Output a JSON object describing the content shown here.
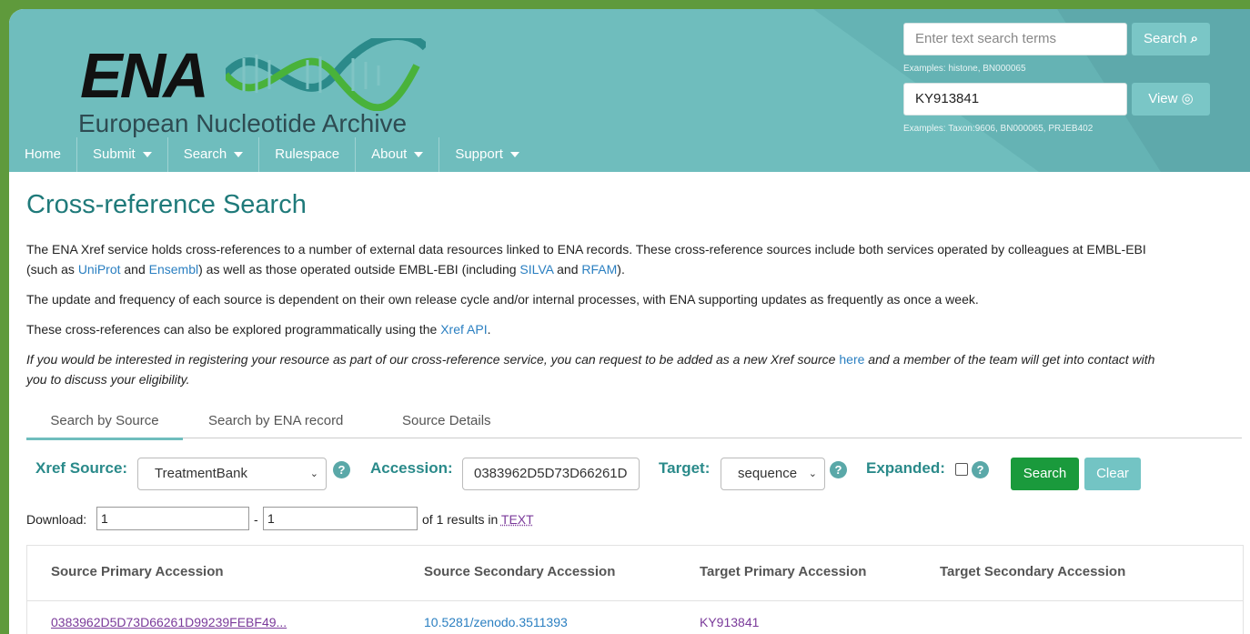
{
  "header": {
    "logo_text": "ENA",
    "logo_subtitle": "European Nucleotide Archive",
    "search_placeholder": "Enter text search terms",
    "search_button": "Search",
    "search_examples": "Examples: histone, BN000065",
    "view_value": "KY913841",
    "view_button": "View",
    "view_examples": "Examples: Taxon:9606, BN000065, PRJEB402"
  },
  "nav": {
    "items": [
      {
        "label": "Home",
        "dropdown": false
      },
      {
        "label": "Submit",
        "dropdown": true
      },
      {
        "label": "Search",
        "dropdown": true
      },
      {
        "label": "Rulespace",
        "dropdown": false
      },
      {
        "label": "About",
        "dropdown": true
      },
      {
        "label": "Support",
        "dropdown": true
      }
    ]
  },
  "page": {
    "title": "Cross-reference Search",
    "p1_a": "The ENA Xref service holds cross-references to a number of external data resources linked to ENA records. These cross-reference sources include both services operated by colleagues at EMBL-EBI",
    "p1_b": "(such as ",
    "p1_link_uniprot": "UniProt",
    "p1_and1": " and ",
    "p1_link_ensembl": "Ensembl",
    "p1_c": ") as well as those operated outside EMBL-EBI (including ",
    "p1_link_silva": "SILVA",
    "p1_and2": " and ",
    "p1_link_rfam": "RFAM",
    "p1_end": ").",
    "p2": "The update and frequency of each source is dependent on their own release cycle and/or internal processes, with ENA supporting updates as frequently as once a week.",
    "p3_a": "These cross-references can also be explored programmatically using the ",
    "p3_link": "Xref API",
    "p3_end": ".",
    "p4_a": "If you would be interested in registering your resource as part of our cross-reference service, you can request to be added as a new Xref source ",
    "p4_link": "here",
    "p4_b": " and a member of the team will get into contact with",
    "p4_c": "you to discuss your eligibility."
  },
  "tabs": [
    "Search by Source",
    "Search by ENA record",
    "Source Details"
  ],
  "form": {
    "xref_label": "Xref Source:",
    "xref_value": "TreatmentBank",
    "accession_label": "Accession:",
    "accession_value": "0383962D5D73D66261D",
    "target_label": "Target:",
    "target_value": "sequence",
    "expanded_label": "Expanded:",
    "help_glyph": "?",
    "search_button": "Search",
    "clear_button": "Clear"
  },
  "download": {
    "label": "Download:",
    "from": "1",
    "dash": "-",
    "to": "1",
    "results_text": "of 1 results in",
    "format_link": "TEXT"
  },
  "table": {
    "headers": [
      "Source Primary Accession",
      "Source Secondary Accession",
      "Target Primary Accession",
      "Target Secondary Accession"
    ],
    "rows": [
      [
        "0383962D5D73D66261D99239FEBF49...",
        "10.5281/zenodo.3511393",
        "KY913841",
        ""
      ]
    ]
  },
  "colors": {
    "header_bg": "#6fbdbd",
    "title": "#1f7a7a",
    "search_green": "#1a9a3c",
    "clear_teal": "#73c4c4",
    "link_blue": "#2a7fc1",
    "link_purple": "#7a3a9a"
  }
}
